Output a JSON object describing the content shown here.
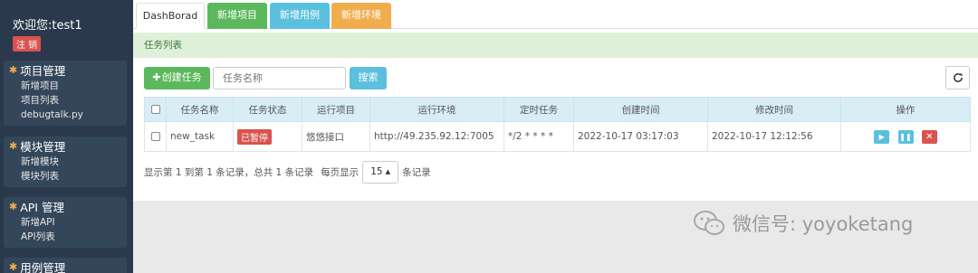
{
  "sidebar": {
    "welcome": "欢迎您:test1",
    "logout_label": "注 销",
    "groups": [
      {
        "title": "项目管理",
        "items": [
          "新增项目",
          "项目列表",
          "debugtalk.py"
        ]
      },
      {
        "title": "模块管理",
        "items": [
          "新增模块",
          "模块列表"
        ]
      },
      {
        "title": "API 管理",
        "items": [
          "新增API",
          "API列表"
        ]
      },
      {
        "title": "用例管理",
        "items": []
      }
    ]
  },
  "tabs": [
    "DashBorad",
    "新增项目",
    "新增用例",
    "新增环境"
  ],
  "panel": {
    "title": "任务列表"
  },
  "toolbar": {
    "create_label": "创建任务",
    "search_placeholder": "任务名称",
    "search_label": "搜索"
  },
  "table": {
    "headers": [
      "任务名称",
      "任务状态",
      "运行项目",
      "运行环境",
      "定时任务",
      "创建时间",
      "修改时间",
      "操作"
    ],
    "rows": [
      {
        "name": "new_task",
        "status": "已暂停",
        "project": "悠悠接口",
        "env": "http://49.235.92.12:7005",
        "cron": "*/2 * * * *",
        "created": "2022-10-17 03:17:03",
        "modified": "2022-10-17 12:12:56"
      }
    ]
  },
  "pager": {
    "summary": "显示第 1 到第 1 条记录，总共 1 条记录",
    "per_page_prefix": "每页显示",
    "page_size": "15",
    "per_page_suffix": "条记录"
  },
  "watermark": {
    "text": "微信号: yoyoketang"
  },
  "colors": {
    "sidebar_bg": "#2a3a4c",
    "success": "#5cb85c",
    "info": "#5bc0de",
    "warning": "#f0ad4e",
    "danger": "#d9534f"
  },
  "icons": {
    "menu_group": "gear-icon",
    "create": "plus-icon",
    "refresh": "refresh-icon",
    "run": "play-icon",
    "pause": "pause-icon",
    "delete": "close-icon"
  }
}
